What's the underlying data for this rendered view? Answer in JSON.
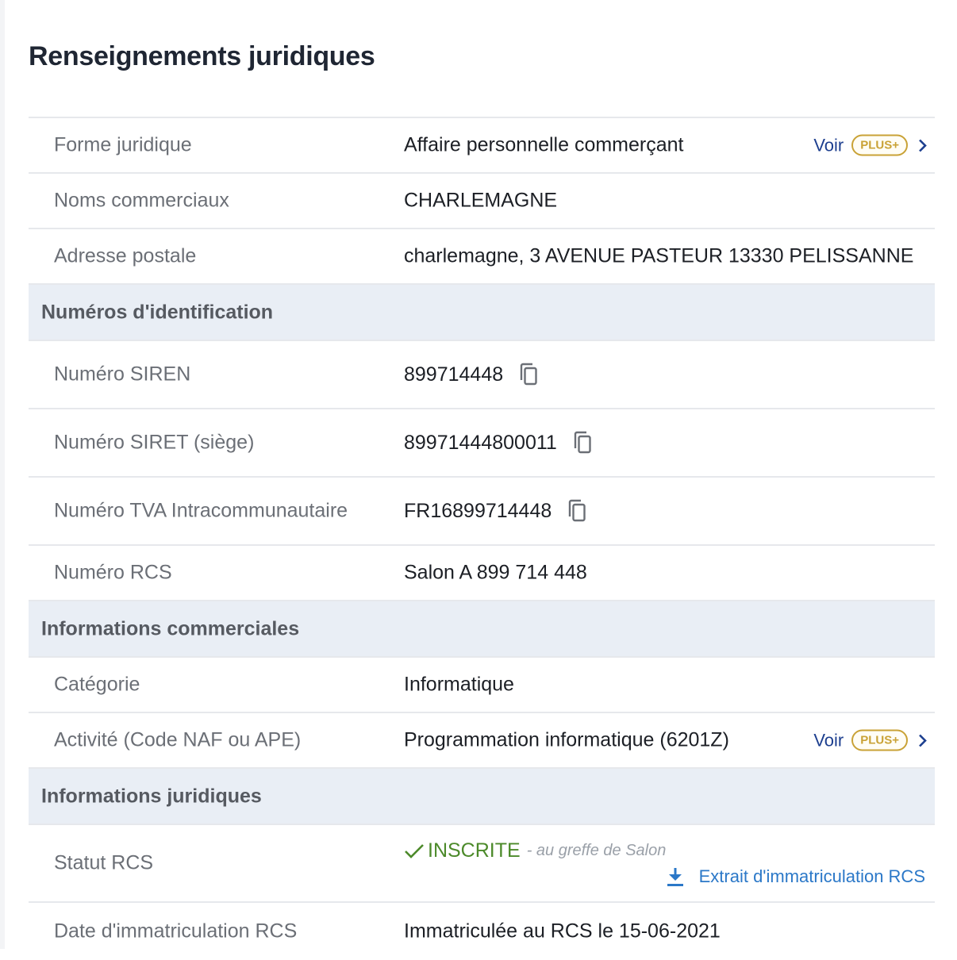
{
  "title": "Renseignements juridiques",
  "rows": {
    "forme": {
      "label": "Forme juridique",
      "value": "Affaire personnelle commerçant"
    },
    "noms": {
      "label": "Noms commerciaux",
      "value": "CHARLEMAGNE"
    },
    "adresse": {
      "label": "Adresse postale",
      "value": "charlemagne, 3 AVENUE PASTEUR 13330 PELISSANNE"
    },
    "siren": {
      "label": "Numéro SIREN",
      "value": "899714448"
    },
    "siret": {
      "label": "Numéro SIRET (siège)",
      "value": "89971444800011"
    },
    "tva": {
      "label": "Numéro TVA Intracommunautaire",
      "value": "FR16899714448"
    },
    "rcs": {
      "label": "Numéro RCS",
      "value": "Salon A 899 714 448"
    },
    "categorie": {
      "label": "Catégorie",
      "value": "Informatique"
    },
    "activite": {
      "label": "Activité (Code NAF ou APE)",
      "value": "Programmation informatique (6201Z)"
    },
    "statut": {
      "label": "Statut RCS",
      "status": "INSCRITE",
      "greffe": "- au greffe de Salon",
      "extrait": "Extrait d'immatriculation RCS"
    },
    "date": {
      "label": "Date d'immatriculation RCS",
      "value": "Immatriculée au RCS le 15-06-2021"
    }
  },
  "sections": {
    "identification": "Numéros d'identification",
    "commerciales": "Informations commerciales",
    "juridiques": "Informations juridiques"
  },
  "voir": {
    "label": "Voir",
    "badge": "PLUS+"
  },
  "colors": {
    "accent": "#1d3f8f",
    "badge": "#c9a236",
    "success": "#4c8a2a",
    "link": "#2b78c8",
    "section_bg": "#e9eef5"
  },
  "icons": [
    "copy-icon",
    "chevron-right-icon",
    "check-icon",
    "download-icon"
  ]
}
